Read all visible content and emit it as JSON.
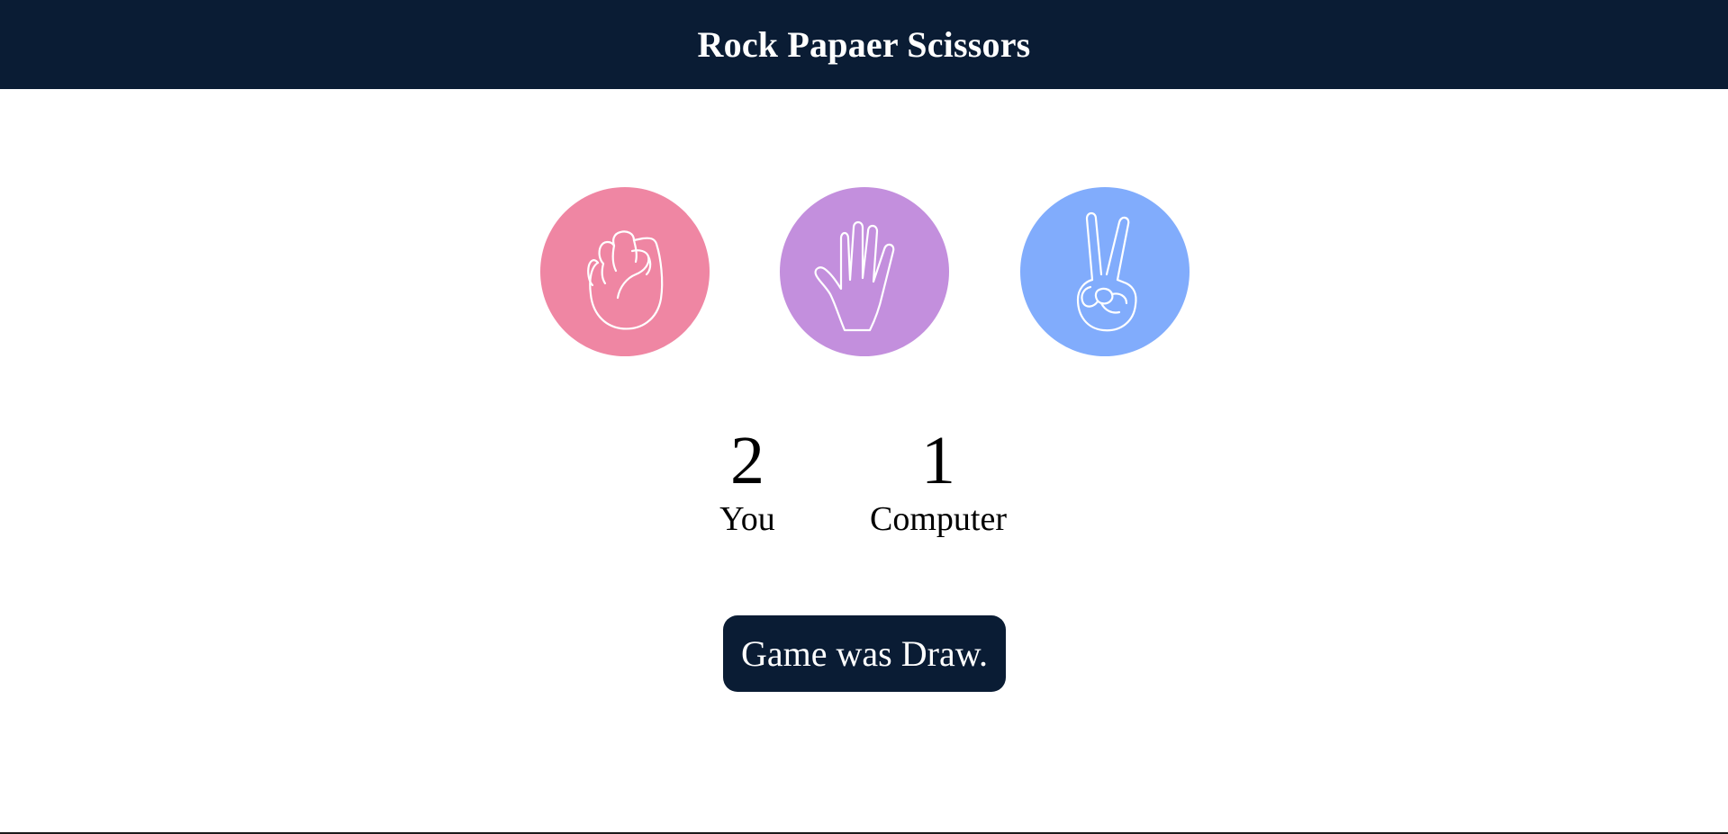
{
  "header": {
    "title": "Rock Papaer Scissors"
  },
  "choices": [
    {
      "id": "rock",
      "icon": "fist-icon",
      "color": "#ef86a3"
    },
    {
      "id": "paper",
      "icon": "open-hand-icon",
      "color": "#c38fdd"
    },
    {
      "id": "scissors",
      "icon": "peace-hand-icon",
      "color": "#81acfc"
    }
  ],
  "score": {
    "user": {
      "value": "2",
      "label": "You"
    },
    "computer": {
      "value": "1",
      "label": "Computer"
    }
  },
  "result": {
    "message": "Game was Draw."
  },
  "colors": {
    "header_bg": "#0a1c34",
    "result_bg": "#0a1c34"
  }
}
